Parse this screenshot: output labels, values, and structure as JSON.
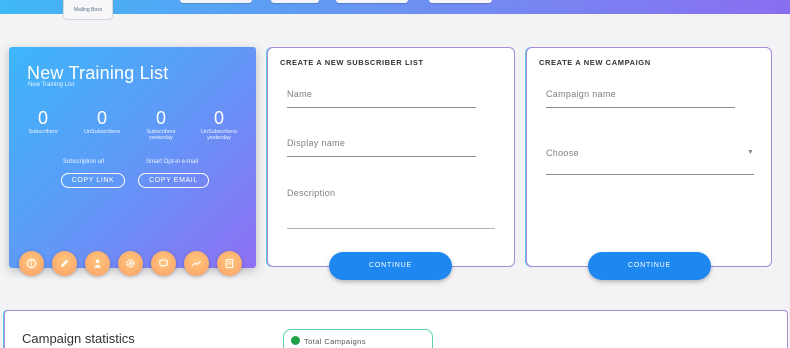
{
  "header": {
    "logo_text": "Mailing Boss"
  },
  "list_card": {
    "title": "New Training List",
    "subtitle": "New Training List",
    "stats": [
      {
        "value": "0",
        "label": "Subscribers"
      },
      {
        "value": "0",
        "label": "UnSubscribers"
      },
      {
        "value": "0",
        "label": "Subscribers yesterday"
      },
      {
        "value": "0",
        "label": "UnSubscribers yesterday"
      }
    ],
    "subscription_url_label": "Subscription url",
    "smart_optin_label": "Smart Opt-in e-mail",
    "copy_link_label": "COPY LINK",
    "copy_email_label": "COPY EMAIL",
    "action_icons": [
      "info-icon",
      "pencil-icon",
      "subscribers-icon",
      "gear-icon",
      "chat-icon",
      "chart-icon",
      "document-icon"
    ]
  },
  "subscriber_form": {
    "title": "CREATE A NEW SUBSCRIBER LIST",
    "name_placeholder": "Name",
    "display_name_placeholder": "Display name",
    "description_placeholder": "Description",
    "continue_label": "CONTINUE"
  },
  "campaign_form": {
    "title": "CREATE A NEW CAMPAIGN",
    "campaign_name_placeholder": "Campaign name",
    "choose_placeholder": "Choose",
    "continue_label": "CONTINUE"
  },
  "statistics": {
    "title": "Campaign statistics",
    "total_campaigns_label": "Total Campaigns"
  },
  "colors": {
    "card_gradient_start": "#3cb6fb",
    "card_gradient_end": "#8e6ff2",
    "button_blue": "#1e88f0",
    "action_orange": "#fba06a"
  }
}
